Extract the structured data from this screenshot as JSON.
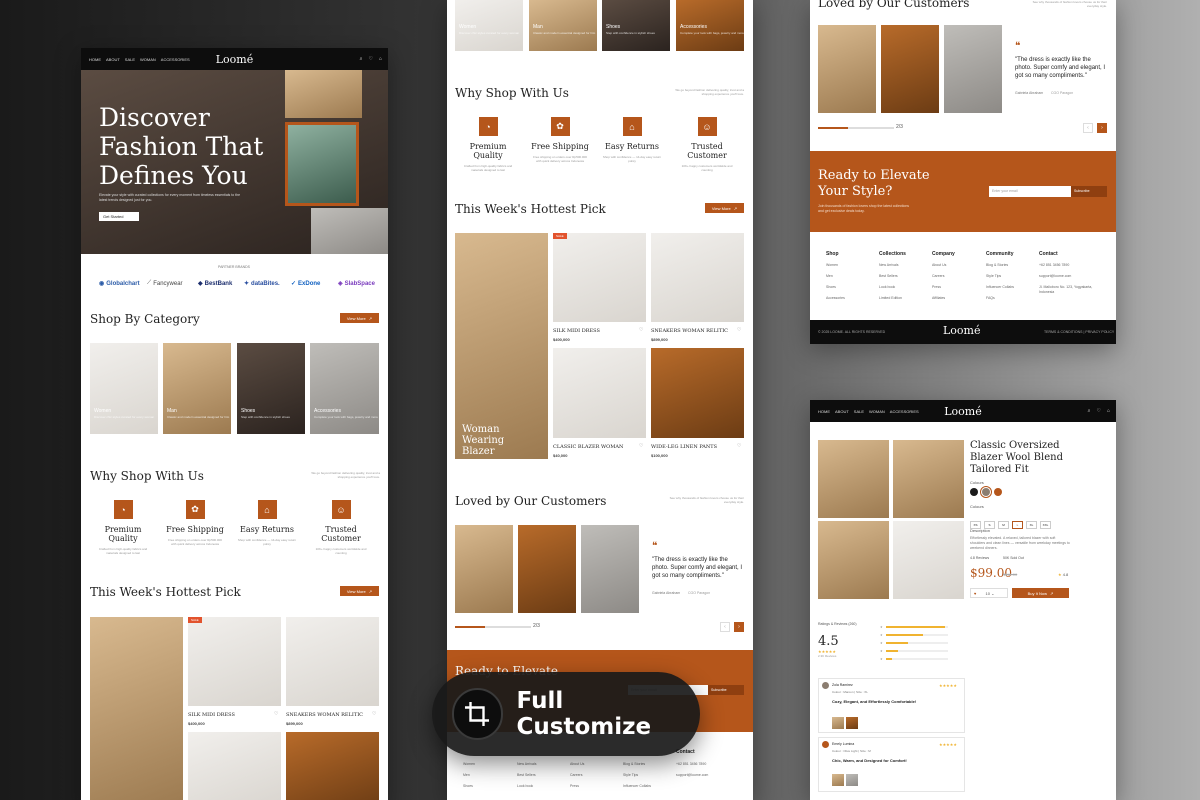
{
  "header": {
    "nav": [
      "HOME",
      "ABOUT",
      "SALE",
      "WOMAN",
      "ACCESSORIES"
    ],
    "logo": "Loomé"
  },
  "hero": {
    "title_lines": [
      "Discover",
      "Fashion That",
      "Defines You"
    ],
    "subtitle": "Elevate your style with curated collections for every moment from timeless essentials to the latest trends designed just for you.",
    "cta": "Get Started"
  },
  "partners": {
    "label": "PARTNER BRANDS",
    "items": [
      "Globalchart",
      "Fancywear",
      "BestBank",
      "dataBites.",
      "ExDone",
      "SlabSpace"
    ]
  },
  "categories": {
    "title": "Shop By Category",
    "view_more": "View More",
    "items": [
      {
        "name": "Women",
        "desc": "Discover chic styles curated for every woman"
      },
      {
        "name": "Man",
        "desc": "Classic and modern essential designed for him"
      },
      {
        "name": "Shoes",
        "desc": "Step with confidence in stylish shoes"
      },
      {
        "name": "Accessories",
        "desc": "Complete your look with bags, jewelry and more"
      }
    ]
  },
  "why": {
    "title": "Why Shop With Us",
    "blurb": "We go beyond fashion delivering quality, trust and a shopping experience you'll love.",
    "features": [
      {
        "icon": "quality-icon",
        "glyph": "◔",
        "title": "Premium Quality",
        "desc": "Crafted from high-quality fabrics and materials designed to last"
      },
      {
        "icon": "shipping-icon",
        "glyph": "✿",
        "title": "Free Shipping",
        "desc": "Free shipping on orders over Rp500.000 with quick delivery across Indonesia"
      },
      {
        "icon": "returns-icon",
        "glyph": "⌂",
        "title": "Easy Returns",
        "desc": "Shop with confidence — 14-day easy return policy"
      },
      {
        "icon": "trusted-icon",
        "glyph": "☺",
        "title": "Trusted Customer",
        "desc": "10K+ happy customers worldwide and counting"
      }
    ]
  },
  "hottest": {
    "title": "This Week's Hottest Pick",
    "view_more": "View More",
    "feature_caption": "Woman Wearing Blazer",
    "sale_badge": "SALE",
    "products": [
      {
        "name": "SILK MIDI DRESS",
        "price": "$400,000"
      },
      {
        "name": "SNEAKERS WOMAN RELITIC",
        "price": "$899,000"
      },
      {
        "name": "CLASSIC BLAZER WOMAN",
        "price": "$40,000"
      },
      {
        "name": "WIDE-LEG LINEN PANTS",
        "price": "$100,000"
      }
    ]
  },
  "testimonials": {
    "title": "Loved by Our Customers",
    "blurb": "See why thousands of fashion lovers choose us for their everyday style.",
    "quote": "\"The dress is exactly like the photo. Super comfy and elegant, I got so many compliments.\"",
    "author": "Gabriela Abraham",
    "role": "CGO Paragon",
    "page": "2/3",
    "quote_mark": "❝"
  },
  "cta": {
    "title_lines": [
      "Ready to Elevate",
      "Your Style?"
    ],
    "desc": "Join thousands of fashion lovers shop the latest collections and get exclusive deals today.",
    "placeholder": "Enter your email",
    "button": "Subscribe"
  },
  "footer": {
    "columns": [
      {
        "head": "Shop",
        "items": [
          "Women",
          "Men",
          "Shoes",
          "Accessories"
        ]
      },
      {
        "head": "Collections",
        "items": [
          "New Arrivals",
          "Best Sellers",
          "Look book",
          "Limited Edition"
        ]
      },
      {
        "head": "Company",
        "items": [
          "About Us",
          "Careers",
          "Press",
          "Affiliates"
        ]
      },
      {
        "head": "Community",
        "items": [
          "Blog & Stories",
          "Style Tips",
          "Influencer Collabs",
          "FAQs"
        ]
      },
      {
        "head": "Contact",
        "items": [
          "+62 851 3456 7890",
          "support@loome.com",
          "Jl. Malioboro No. 123, Yogyakarta, Indonesia"
        ]
      }
    ],
    "copyright": "© 2025 LOOME. ALL RIGHTS RESERVED",
    "logo": "Loomé",
    "links": "TERMS & CONDITIONS | PRIVACY POLICY"
  },
  "product": {
    "title_lines": [
      "Classic Oversized",
      "Blazer Wool Blend",
      "Tailored Fit"
    ],
    "colours_label": "Colours",
    "colors": [
      "#1b1b1b",
      "#8b7d70",
      "#b5561b"
    ],
    "size_label": "Colours",
    "sizes": [
      "XS",
      "S",
      "M",
      "L",
      "XL",
      "XXL"
    ],
    "desc_label": "Description",
    "desc": "Effortlessly elevated. A relaxed, tailored blazer with soft shoulders and clean lines — versatile from weekday meetings to weekend dinners.",
    "rating_meta": "4.8 Reviews",
    "sold": "50K Sold Out",
    "price": "$99.00",
    "old_price": "$119.00",
    "rating_badge": "4.8",
    "qty": "10",
    "buy": "Buy It Now"
  },
  "ratings": {
    "label": "Ratings & Reviews (260)",
    "score": "4.5",
    "stars": "★★★★★",
    "count": "2.3K Reviews",
    "levels": [
      0.95,
      0.6,
      0.35,
      0.2,
      0.1
    ],
    "reviews": [
      {
        "name": "Zola Ramirez",
        "meta": "Colour : Maroon | Size : XL",
        "title": "Cozy, Elegant, and Effortlessly Comfortable!",
        "stars": "★★★★★"
      },
      {
        "name": "Emely Lumina",
        "meta": "Colour : Olive Light | Size : M",
        "title": "Chic, Warm, and Designed for Comfort!",
        "stars": "★★★★★"
      }
    ]
  },
  "badge": {
    "label": "Full Customize"
  }
}
